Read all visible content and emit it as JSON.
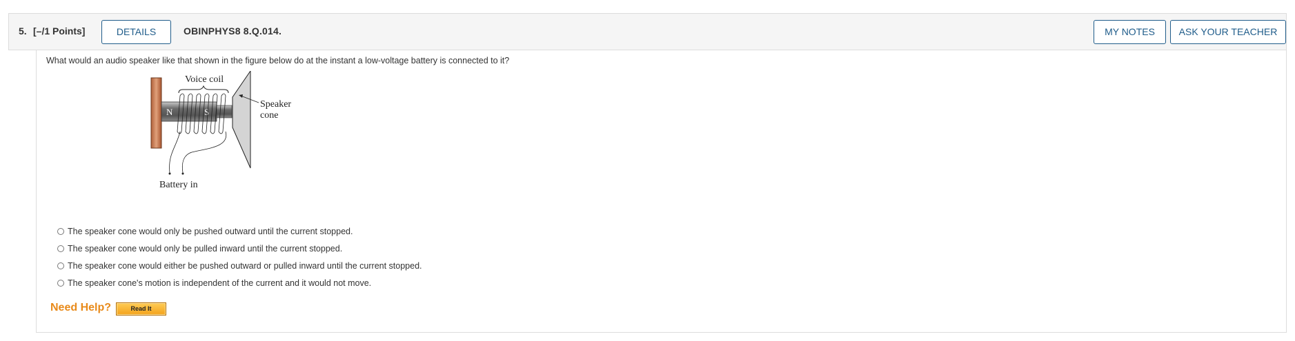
{
  "question": {
    "number": "5.",
    "points": "[–/1 Points]",
    "details_button": "DETAILS",
    "code": "OBINPHYS8 8.Q.014.",
    "my_notes_button": "MY NOTES",
    "ask_teacher_button": "ASK YOUR TEACHER",
    "prompt": "What would an audio speaker like that shown in the figure below do at the instant a low-voltage battery is connected to it?"
  },
  "figure": {
    "voice_coil_label": "Voice coil",
    "speaker_label_line1": "Speaker",
    "speaker_label_line2": "cone",
    "battery_label": "Battery in",
    "north_pole": "N",
    "south_pole": "S"
  },
  "choices": [
    "The speaker cone would only be pushed outward until the current stopped.",
    "The speaker cone would only be pulled inward until the current stopped.",
    "The speaker cone would either be pushed outward or pulled inward until the current stopped.",
    "The speaker cone's motion is independent of the current and it would not move."
  ],
  "help": {
    "need_help": "Need Help?",
    "read_it": "Read It"
  }
}
